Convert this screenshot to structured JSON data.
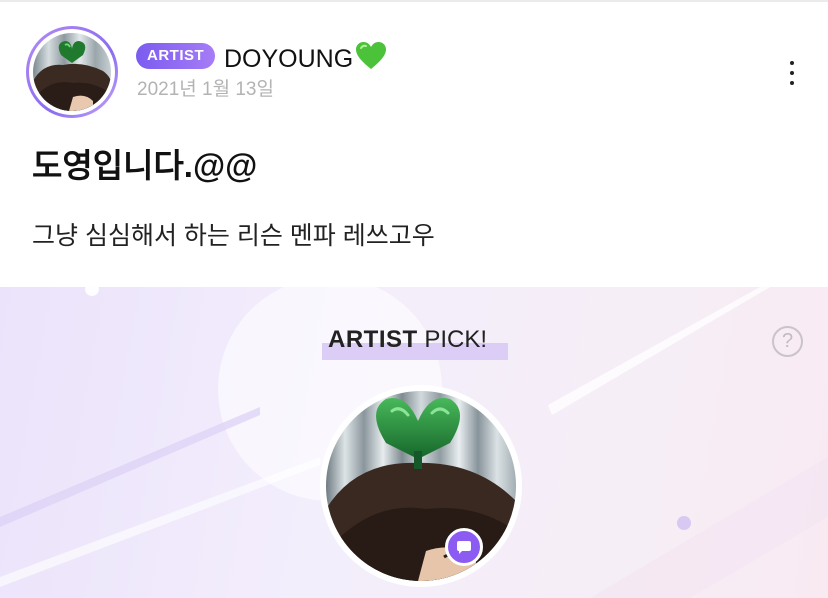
{
  "post": {
    "badge": "ARTIST",
    "author": "DOYOUNG",
    "heart_icon": "green-heart-emoji",
    "date": "2021년 1월 13일",
    "title": "도영입니다.@@",
    "body": "그냥 심심해서 하는 리슨 멘파 레쓰고우",
    "more_icon": "vertical-ellipsis-icon"
  },
  "artist_pick": {
    "title_bold": "ARTIST",
    "title_rest": " PICK!",
    "help_label": "?",
    "chat_icon": "chat-bubble-icon"
  },
  "colors": {
    "accent": "#8c5cf2",
    "badge_start": "#7b5cf0",
    "badge_end": "#a67cf6",
    "date_gray": "#b3b3b3",
    "heart_green": "#4cc23a"
  }
}
